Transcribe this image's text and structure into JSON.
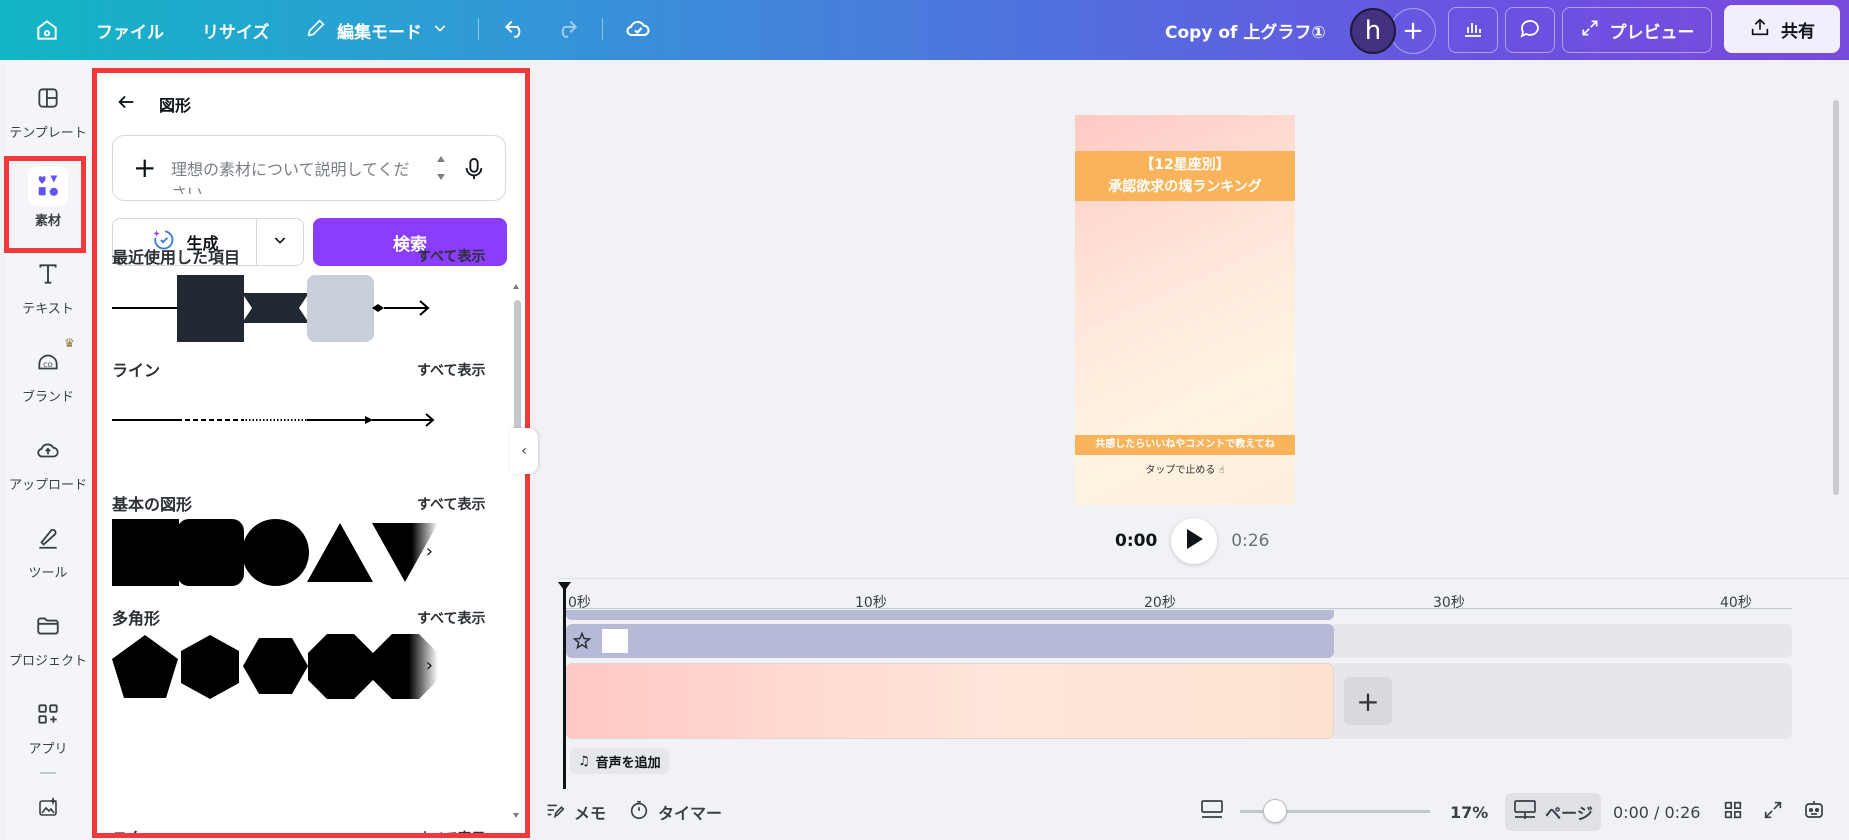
{
  "topbar": {
    "file": "ファイル",
    "resize": "リサイズ",
    "edit_mode": "編集モード",
    "doc_title": "Copy of 上グラフ①",
    "avatar_letter": "h",
    "preview": "プレビュー",
    "share": "共有"
  },
  "rail": [
    {
      "label": "テンプレート",
      "icon": "template-icon"
    },
    {
      "label": "素材",
      "icon": "elements-icon"
    },
    {
      "label": "テキスト",
      "icon": "text-icon"
    },
    {
      "label": "ブランド",
      "icon": "brand-icon"
    },
    {
      "label": "アップロード",
      "icon": "upload-icon"
    },
    {
      "label": "ツール",
      "icon": "tools-icon"
    },
    {
      "label": "プロジェクト",
      "icon": "folder-icon"
    },
    {
      "label": "アプリ",
      "icon": "apps-icon"
    }
  ],
  "panel": {
    "title": "図形",
    "search_placeholder": "理想の素材について説明してください",
    "generate": "生成",
    "search": "検索",
    "sections": [
      {
        "title": "最近使用した項目",
        "see_all": "すべて表示"
      },
      {
        "title": "ライン",
        "see_all": "すべて表示"
      },
      {
        "title": "基本の図形",
        "see_all": "すべて表示"
      },
      {
        "title": "多角形",
        "see_all": "すべて表示"
      },
      {
        "title": "スター",
        "see_all": "すべて表示"
      }
    ]
  },
  "design": {
    "band_title_line1": "【12星座別】",
    "band_title_line2": "承認欲求の塊ランキング",
    "band_bottom": "共感したらいいねやコメントで教えてね",
    "tap_text": "タップで止める"
  },
  "player": {
    "current": "0:00",
    "duration": "0:26"
  },
  "timeline": {
    "ticks": [
      "0秒",
      "10秒",
      "20秒",
      "30秒",
      "40秒"
    ],
    "add_audio": "音声を追加"
  },
  "bottombar": {
    "memo": "メモ",
    "timer": "タイマー",
    "zoom": "17%",
    "page": "ページ",
    "time": "0:00 / 0:26"
  },
  "colors": {
    "accent": "#8b3dff",
    "highlight": "#f03a3a",
    "band": "#f9b35a"
  }
}
